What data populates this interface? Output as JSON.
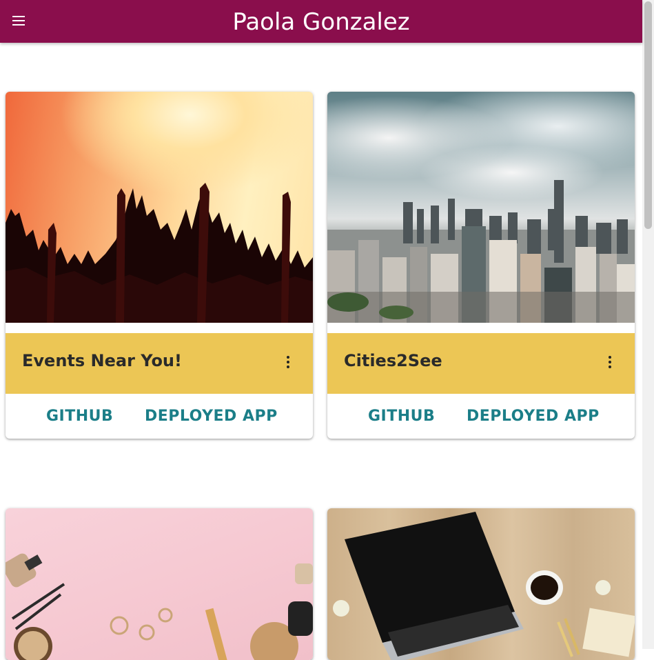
{
  "header": {
    "title": "Paola Gonzalez",
    "menu_icon": "hamburger-menu-icon",
    "background": "#8a0e4c"
  },
  "cards": [
    {
      "title": "Events Near You!",
      "image": "concert-crowd-photo",
      "actions": [
        "GITHUB",
        "DEPLOYED APP"
      ],
      "more_icon": "more-vert-icon"
    },
    {
      "title": "Cities2See",
      "image": "city-skyline-photo",
      "actions": [
        "GITHUB",
        "DEPLOYED APP"
      ],
      "more_icon": "more-vert-icon"
    },
    {
      "image": "salon-tools-photo"
    },
    {
      "image": "laptop-desk-photo"
    }
  ],
  "colors": {
    "card_header": "#ecc655",
    "action_link": "#1b7e88"
  }
}
